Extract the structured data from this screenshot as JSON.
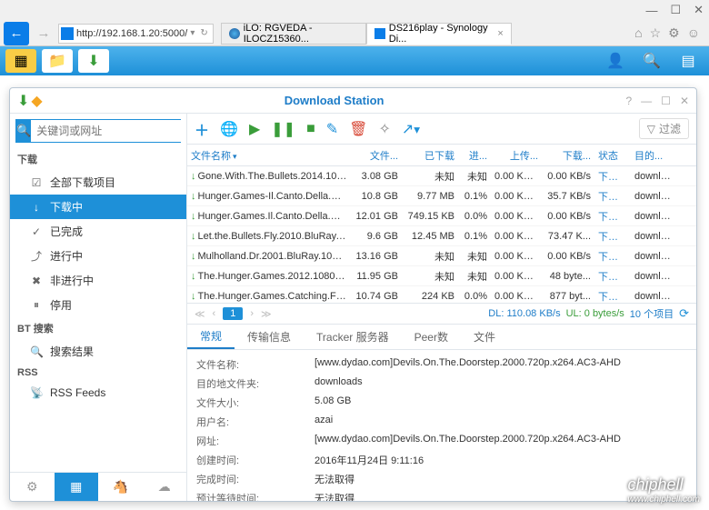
{
  "browser": {
    "url": "http://192.168.1.20:5000/",
    "tabs": [
      {
        "label": "iLO: RGVEDA - ILOCZ15360..."
      },
      {
        "label": "DS216play - Synology Di..."
      }
    ]
  },
  "app": {
    "title": "Download Station",
    "search_placeholder": "关键词或网址",
    "filter_label": "过滤"
  },
  "sidebar": {
    "download_header": "下载",
    "items": [
      {
        "icon": "☑",
        "label": "全部下载项目"
      },
      {
        "icon": "↓",
        "label": "下载中"
      },
      {
        "icon": "✓",
        "label": "已完成"
      },
      {
        "icon": "⤴",
        "label": "进行中"
      },
      {
        "icon": "✖",
        "label": "非进行中"
      },
      {
        "icon": "⏸",
        "label": "停用"
      }
    ],
    "bt_header": "BT 搜索",
    "bt_item": {
      "icon": "🔍",
      "label": "搜索结果"
    },
    "rss_header": "RSS",
    "rss_item": {
      "icon": "📡",
      "label": "RSS Feeds"
    }
  },
  "columns": {
    "name": "文件名称",
    "size": "文件...",
    "done": "已下载",
    "prog": "进...",
    "up": "上传...",
    "down": "下载...",
    "status": "状态",
    "dest": "目的..."
  },
  "rows": [
    {
      "name": "Gone.With.The.Bullets.2014.108...",
      "size": "3.08 GB",
      "done": "未知",
      "prog": "未知",
      "up": "0.00 KB...",
      "down": "0.00 KB/s",
      "status": "下载中",
      "dest": "downlo..."
    },
    {
      "name": "Hunger.Games-Il.Canto.Della.Riv...",
      "size": "10.8 GB",
      "done": "9.77 MB",
      "prog": "0.1%",
      "up": "0.00 KB...",
      "down": "35.7 KB/s",
      "status": "下载中",
      "dest": "downlo..."
    },
    {
      "name": "Hunger.Games.Il.Canto.Della.Riv...",
      "size": "12.01 GB",
      "done": "749.15 KB",
      "prog": "0.0%",
      "up": "0.00 KB...",
      "down": "0.00 KB/s",
      "status": "下载中",
      "dest": "downlo..."
    },
    {
      "name": "Let.the.Bullets.Fly.2010.BluRay.1...",
      "size": "9.6 GB",
      "done": "12.45 MB",
      "prog": "0.1%",
      "up": "0.00 KB...",
      "down": "73.47 K...",
      "status": "下载中",
      "dest": "downlo..."
    },
    {
      "name": "Mulholland.Dr.2001.BluRay.1080...",
      "size": "13.16 GB",
      "done": "未知",
      "prog": "未知",
      "up": "0.00 KB...",
      "down": "0.00 KB/s",
      "status": "下载中",
      "dest": "downlo..."
    },
    {
      "name": "The.Hunger.Games.2012.1080p....",
      "size": "11.95 GB",
      "done": "未知",
      "prog": "未知",
      "up": "0.00 KB...",
      "down": "48 byte...",
      "status": "下载中",
      "dest": "downlo..."
    },
    {
      "name": "The.Hunger.Games.Catching.Fire...",
      "size": "10.74 GB",
      "done": "224 KB",
      "prog": "0.0%",
      "up": "0.00 KB...",
      "down": "877 byt...",
      "status": "下载中",
      "dest": "downlo..."
    }
  ],
  "status": {
    "page": "1",
    "dl": "DL: 110.08 KB/s",
    "ul": "UL: 0 bytes/s",
    "count": "10 个项目"
  },
  "detail_tabs": [
    "常规",
    "传输信息",
    "Tracker 服务器",
    "Peer数",
    "文件"
  ],
  "detail": {
    "labels": {
      "name": "文件名称:",
      "dest": "目的地文件夹:",
      "size": "文件大小:",
      "user": "用户名:",
      "url": "网址:",
      "created": "创建时间:",
      "finished": "完成时间:",
      "eta": "预计等待时间:"
    },
    "values": {
      "name": "[www.dydao.com]Devils.On.The.Doorstep.2000.720p.x264.AC3-AHD",
      "dest": "downloads",
      "size": "5.08 GB",
      "user": "azai",
      "url": "[www.dydao.com]Devils.On.The.Doorstep.2000.720p.x264.AC3-AHD",
      "created": "2016年11月24日 9:11:16",
      "finished": "无法取得",
      "eta": "无法取得"
    }
  },
  "watermark": {
    "brand": "chiphell",
    "url": "www.chiphell.com"
  }
}
